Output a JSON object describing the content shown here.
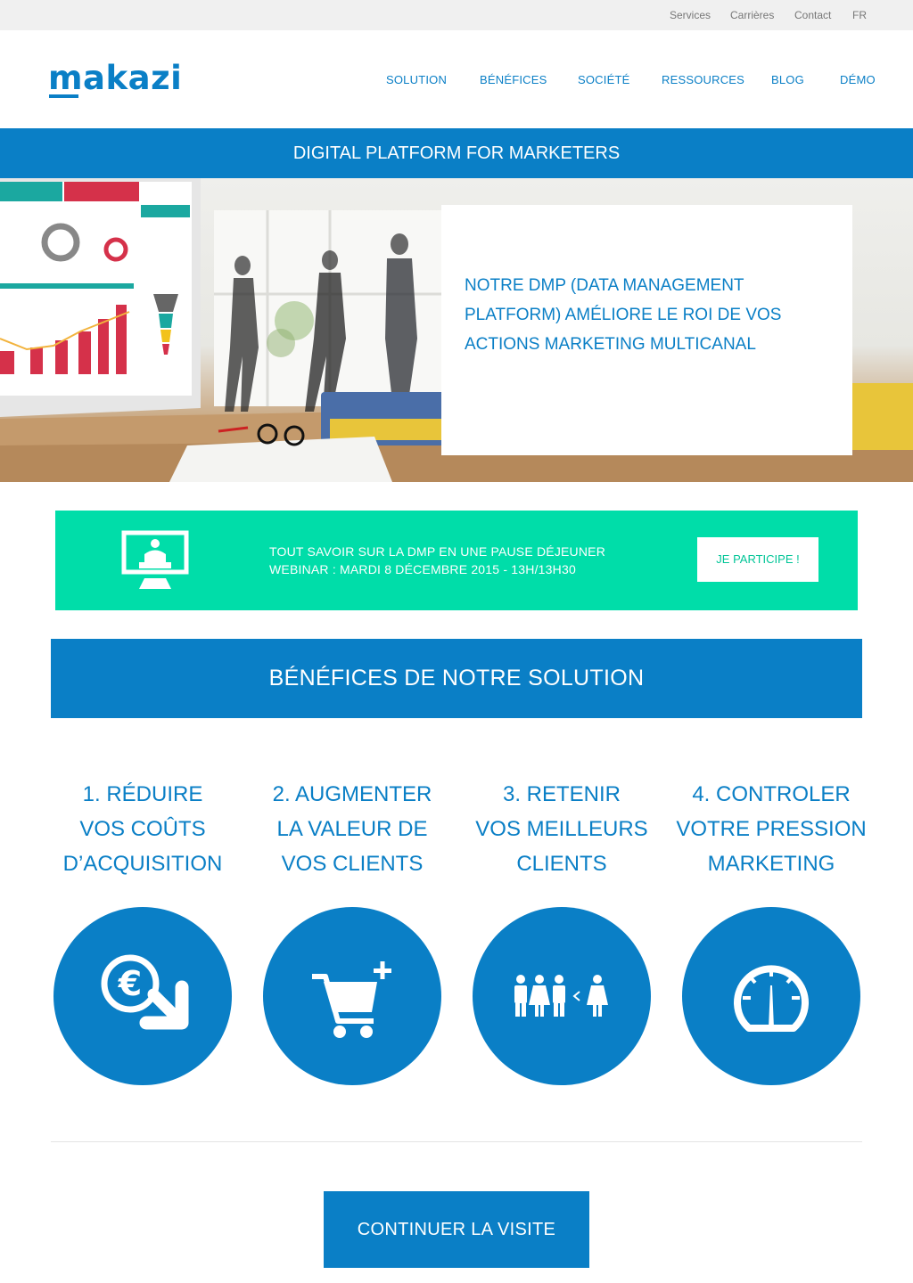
{
  "topbar": {
    "links": [
      "Services",
      "Carrières",
      "Contact",
      "FR"
    ]
  },
  "header": {
    "logo": "makazi",
    "nav": [
      "SOLUTION",
      "BÉNÉFICES",
      "SOCIÉTÉ",
      "RESSOURCES",
      "BLOG",
      "DÉMO"
    ]
  },
  "banner": {
    "title": "DIGITAL PLATFORM FOR MARKETERS"
  },
  "hero": {
    "headline": "NOTRE DMP (DATA MANAGEMENT PLATFORM) AMÉLIORE LE ROI DE VOS ACTIONS MARKETING MULTICANAL"
  },
  "promo": {
    "line1": "TOUT SAVOIR SUR LA DMP EN UNE PAUSE DÉJEUNER",
    "line2": "WEBINAR : MARDI 8 DÉCEMBRE 2015 - 13H/13H30",
    "button": "JE PARTICIPE !",
    "icon": "webinar-presenter-icon"
  },
  "benefits": {
    "heading": "BÉNÉFICES DE NOTRE SOLUTION",
    "items": [
      {
        "lines": [
          "1. RÉDUIRE",
          "VOS COÛTS",
          "D’ACQUISITION"
        ],
        "icon": "euro-down-icon"
      },
      {
        "lines": [
          "2. AUGMENTER",
          "LA VALEUR DE",
          "VOS CLIENTS"
        ],
        "icon": "cart-plus-icon"
      },
      {
        "lines": [
          "3. RETENIR",
          "VOS MEILLEURS",
          "CLIENTS"
        ],
        "icon": "people-icon"
      },
      {
        "lines": [
          "4. CONTROLER",
          "VOTRE PRESSION",
          "MARKETING"
        ],
        "icon": "gauge-icon"
      }
    ]
  },
  "cta": {
    "label": "CONTINUER LA VISITE"
  },
  "colors": {
    "primary": "#0a7fc6",
    "promo": "#00dda9",
    "topbar": "#f0f0f0"
  }
}
